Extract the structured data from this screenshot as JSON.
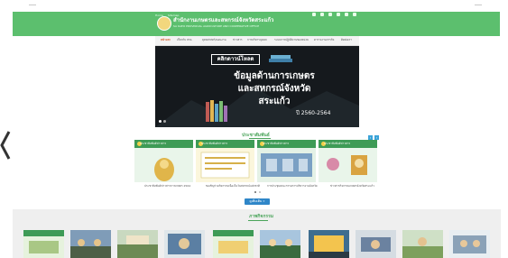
{
  "header": {
    "mini_left": [
      "Home",
      "Sitemap"
    ],
    "office_title": "สำนักงานเกษตรและสหกรณ์จังหวัดสระแก้ว",
    "office_sub": "SA KAEO PROVINCIAL AGRICULTURE AND COOPERATIVE OFFICE",
    "social_icons": [
      "facebook-icon",
      "youtube-icon",
      "rss-icon",
      "mail-icon",
      "phone-icon",
      "search-icon"
    ]
  },
  "nav": {
    "items": [
      "หน้าแรก",
      "เกี่ยวกับ สกจ.",
      "ยุทธศาสตร์/แผนงาน",
      "ข่าวสาร",
      "การบริหารบุคคล",
      "ระบบการปฏิบัติงานของหน่วย",
      "ตารางงานภารกิจ",
      "ติดต่อเรา"
    ]
  },
  "hero": {
    "badge": "คลิกดาวน์โหลด",
    "line1": "ข้อมูลด้านการเกษตร",
    "line2": "และสหกรณ์จังหวัด",
    "line3": "สระแก้ว",
    "year": "ปี 2560-2564"
  },
  "pr": {
    "title": "ประชาสัมพันธ์",
    "cards": [
      {
        "ribbon": "ประชาสัมพันธ์ข่าวสาร",
        "caption": "ประชาสัมพันธ์ข่าวสารการเกษตร 2564"
      },
      {
        "ribbon": "ประชาสัมพันธ์ข่าวสาร",
        "caption": "ขอเชิญร่วมกิจกรรมเนื่องในวันสหกรณ์แห่งชาติ"
      },
      {
        "ribbon": "ประชาสัมพันธ์ข่าวสาร",
        "caption": "การประชุมคณะกรรมการบริหารงานจังหวัด"
      },
      {
        "ribbon": "ประชาสัมพันธ์ข่าวสาร",
        "caption": "ข่าวสารกิจกรรมเกษตรจังหวัดสระแก้ว"
      }
    ],
    "more": "ดูเพิ่มเติม »"
  },
  "activity": {
    "title": "ภาพกิจกรรม"
  },
  "colors": {
    "header_green": "#5cbf6e",
    "accent_green": "#4aa45a",
    "button_blue": "#2f86c8"
  }
}
